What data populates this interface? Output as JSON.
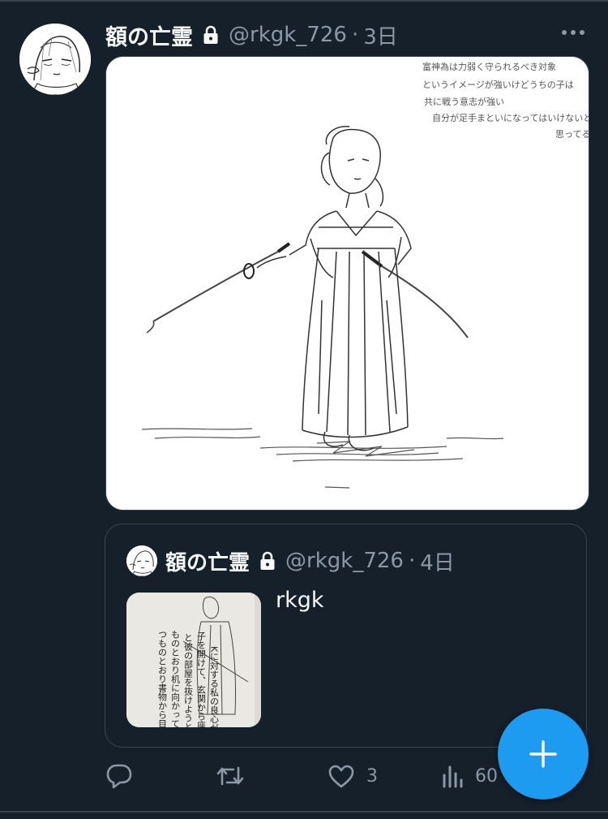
{
  "post": {
    "display_name": "額の亡霊",
    "handle": "@rkgk_726",
    "separator": "·",
    "time": "3日",
    "image": {
      "note_lines": [
        "富神為は力弱く守られるべき対象",
        "というイメージが強いけどうちの子は",
        "共に戦う意志が強い",
        "自分が足手まといになってはいけないと",
        "思ってる"
      ]
    }
  },
  "quote": {
    "display_name": "額の亡霊",
    "handle": "@rkgk_726",
    "separator": "·",
    "time": "4日",
    "text": "rkgk",
    "thumb_text_lines": [
      "Kに対する私の良心が復",
      "子を開けて、玄関から座敷で",
      "と彼の部屋を抜けようと",
      "ものとおり机に向かって書",
      "つものとおり書物から目を"
    ]
  },
  "actions": {
    "reply": {
      "icon": "reply-icon"
    },
    "retweet": {
      "icon": "retweet-icon"
    },
    "like": {
      "icon": "heart-icon",
      "count": "3"
    },
    "views": {
      "icon": "views-icon",
      "count": "60"
    },
    "compose": {
      "icon": "plus-icon"
    }
  },
  "colors": {
    "background": "#15202b",
    "text": "#e7e9ea",
    "muted": "#8b98a5",
    "border": "#38444d",
    "accent": "#1d9bf0"
  }
}
